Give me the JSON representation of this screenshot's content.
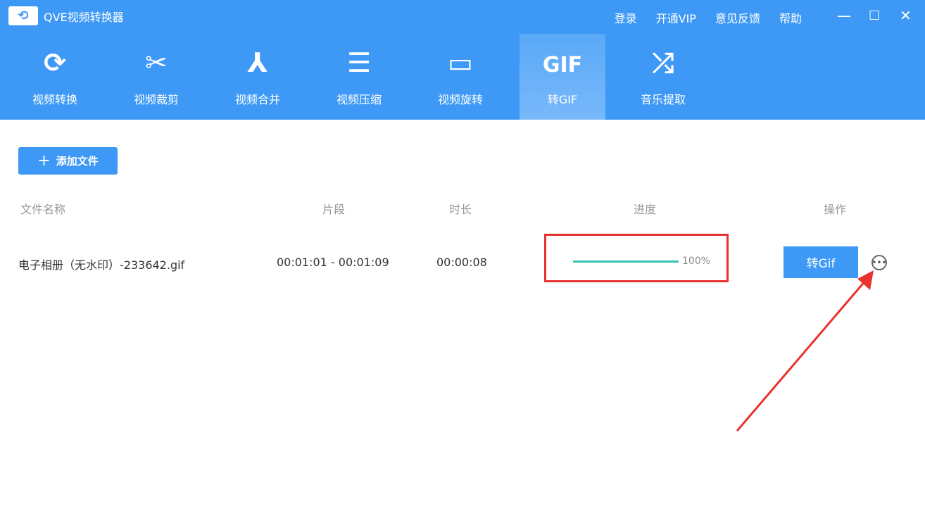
{
  "app": {
    "title": "QVE视频转换器"
  },
  "top_links": [
    "登录",
    "开通VIP",
    "意见反馈",
    "帮助"
  ],
  "tabs": [
    {
      "label": "视频转换",
      "icon": "⟳"
    },
    {
      "label": "视频裁剪",
      "icon": "✂"
    },
    {
      "label": "视频合并",
      "icon": "⅄"
    },
    {
      "label": "视频压缩",
      "icon": "☰"
    },
    {
      "label": "视频旋转",
      "icon": "▭"
    },
    {
      "label": "转GIF",
      "icon": "GIF"
    },
    {
      "label": "音乐提取",
      "icon": "⤮"
    }
  ],
  "add_button": "添加文件",
  "columns": [
    "文件名称",
    "片段",
    "时长",
    "进度",
    "操作"
  ],
  "rows": [
    {
      "name": "电子相册（无水印）-233642.gif",
      "segment": "00:01:01 - 00:01:09",
      "duration": "00:00:08",
      "progress": 100,
      "progress_label": "100%",
      "action": "转Gif"
    }
  ],
  "colors": {
    "brand": "#3d99f5",
    "progress": "#36c2b0",
    "annotation": "#e8332f"
  }
}
